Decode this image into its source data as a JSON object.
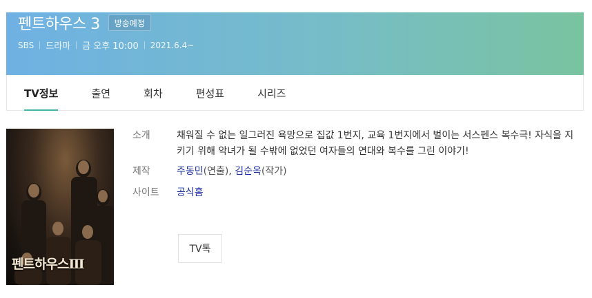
{
  "header": {
    "title": "펜트하우스 3",
    "badge": "방송예정",
    "channel": "SBS",
    "genre": "드라마",
    "schedule": "금 오후 10:00",
    "start_date": "2021.6.4~"
  },
  "tabs": [
    {
      "label": "TV정보",
      "active": true
    },
    {
      "label": "출연",
      "active": false
    },
    {
      "label": "회차",
      "active": false
    },
    {
      "label": "편성표",
      "active": false
    },
    {
      "label": "시리즈",
      "active": false
    }
  ],
  "poster": {
    "title_art": "펜트하우스Ⅲ"
  },
  "info": {
    "intro_label": "소개",
    "intro_text": "채워질 수 없는 일그러진 욕망으로 집값 1번지, 교육 1번지에서 벌이는 서스펜스 복수극! 자식을 지키기 위해 악녀가 될 수밖에 없었던 여자들의 연대와 복수를 그린 이야기!",
    "crew_label": "제작",
    "crew": [
      {
        "name": "주동민",
        "role": "(연출)",
        "sep": ", "
      },
      {
        "name": "김순옥",
        "role": "(작가)",
        "sep": ""
      }
    ],
    "site_label": "사이트",
    "site_link": "공식홈"
  },
  "tvtalk_button": "TV톡",
  "colors": {
    "accent": "#3fb5a8",
    "link": "#1a2fa0",
    "banner_start": "#6fb1e3",
    "banner_end": "#7ac3a0"
  }
}
